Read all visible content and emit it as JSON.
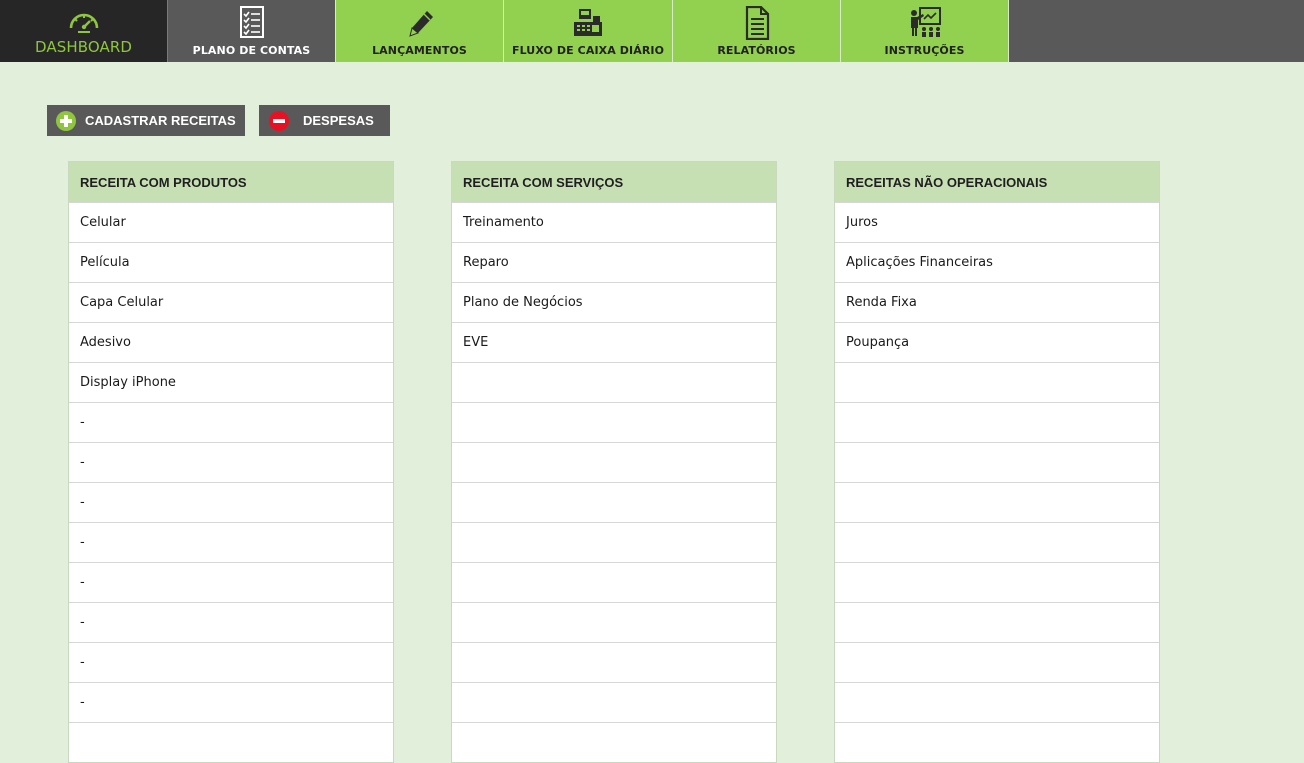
{
  "nav": {
    "dashboard": "DASHBOARD",
    "plano_de_contas": "PLANO DE CONTAS",
    "lancamentos": "LANÇAMENTOS",
    "fluxo_de_caixa": "FLUXO DE CAIXA DIÁRIO",
    "relatorios": "RELATÓRIOS",
    "instrucoes": "INSTRUÇÕES"
  },
  "actions": {
    "cadastrar_receitas": "CADASTRAR RECEITAS",
    "despesas": "DESPESAS"
  },
  "tables": [
    {
      "header": "RECEITA COM PRODUTOS",
      "rows": [
        "Celular",
        "Película",
        "Capa Celular",
        "Adesivo",
        "Display iPhone",
        "-",
        "-",
        "-",
        "-",
        "-",
        "-",
        "-",
        "-",
        ""
      ]
    },
    {
      "header": "RECEITA COM SERVIÇOS",
      "rows": [
        "Treinamento",
        "Reparo",
        "Plano de Negócios",
        "EVE",
        "",
        "",
        "",
        "",
        "",
        "",
        "",
        "",
        "",
        ""
      ]
    },
    {
      "header": "RECEITAS NÃO OPERACIONAIS",
      "rows": [
        "Juros",
        "Aplicações Financeiras",
        "Renda Fixa",
        "Poupança",
        "",
        "",
        "",
        "",
        "",
        "",
        "",
        "",
        "",
        ""
      ]
    }
  ],
  "colors": {
    "accent_green": "#92d050",
    "header_green": "#c6e0b4",
    "background": "#e2efdb",
    "dark_gray": "#595959",
    "plus_green": "#8fc63e",
    "minus_red": "#e81123"
  },
  "icons": {
    "dashboard": "gauge-icon",
    "plano": "checklist-icon",
    "lancamentos": "pencil-icon",
    "fluxo": "cash-register-icon",
    "relatorios": "document-icon",
    "instrucoes": "presentation-icon",
    "cadastrar": "plus-circle-icon",
    "despesas": "minus-circle-icon"
  }
}
